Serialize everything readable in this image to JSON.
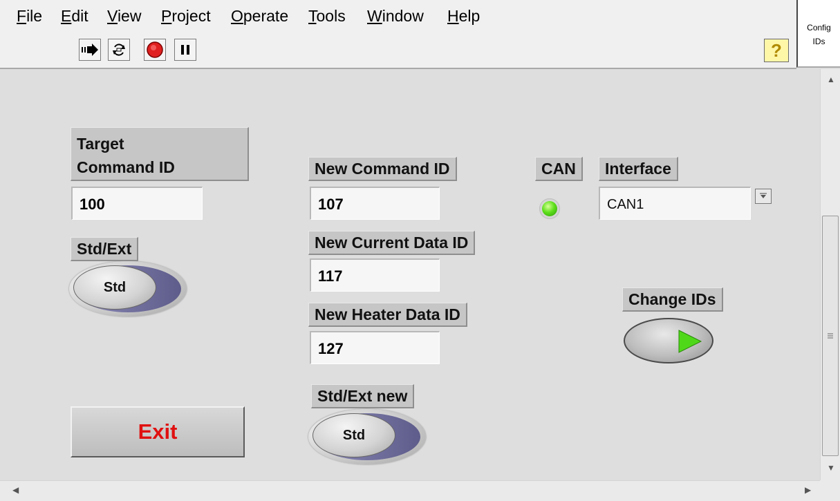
{
  "menu": {
    "items": [
      "File",
      "Edit",
      "View",
      "Project",
      "Operate",
      "Tools",
      "Window",
      "Help"
    ],
    "mnemonics": [
      "F",
      "E",
      "V",
      "P",
      "O",
      "T",
      "W",
      "H"
    ]
  },
  "toolbar": {
    "buttons": [
      "run-arrow-icon",
      "run-continuously-icon",
      "abort-icon",
      "pause-icon"
    ],
    "help_glyph": "?"
  },
  "config_panel": {
    "line1": "Config",
    "line2": "IDs"
  },
  "target": {
    "label_line1": "Target",
    "label_line2": "Command ID",
    "value": "100"
  },
  "std_ext": {
    "label": "Std/Ext",
    "state": "Std"
  },
  "new_command": {
    "label": "New Command ID",
    "value": "107"
  },
  "new_current": {
    "label": "New Current Data ID",
    "value": "117"
  },
  "new_heater": {
    "label": "New Heater Data ID",
    "value": "127"
  },
  "std_ext_new": {
    "label": "Std/Ext new",
    "state": "Std"
  },
  "can": {
    "label": "CAN",
    "led_color": "#5fe01c",
    "led_on": true
  },
  "interface": {
    "label": "Interface",
    "value": "CAN1"
  },
  "change_ids": {
    "label": "Change IDs",
    "arrow_color": "#4fd81a"
  },
  "exit": {
    "label": "Exit",
    "color": "#e01010"
  }
}
